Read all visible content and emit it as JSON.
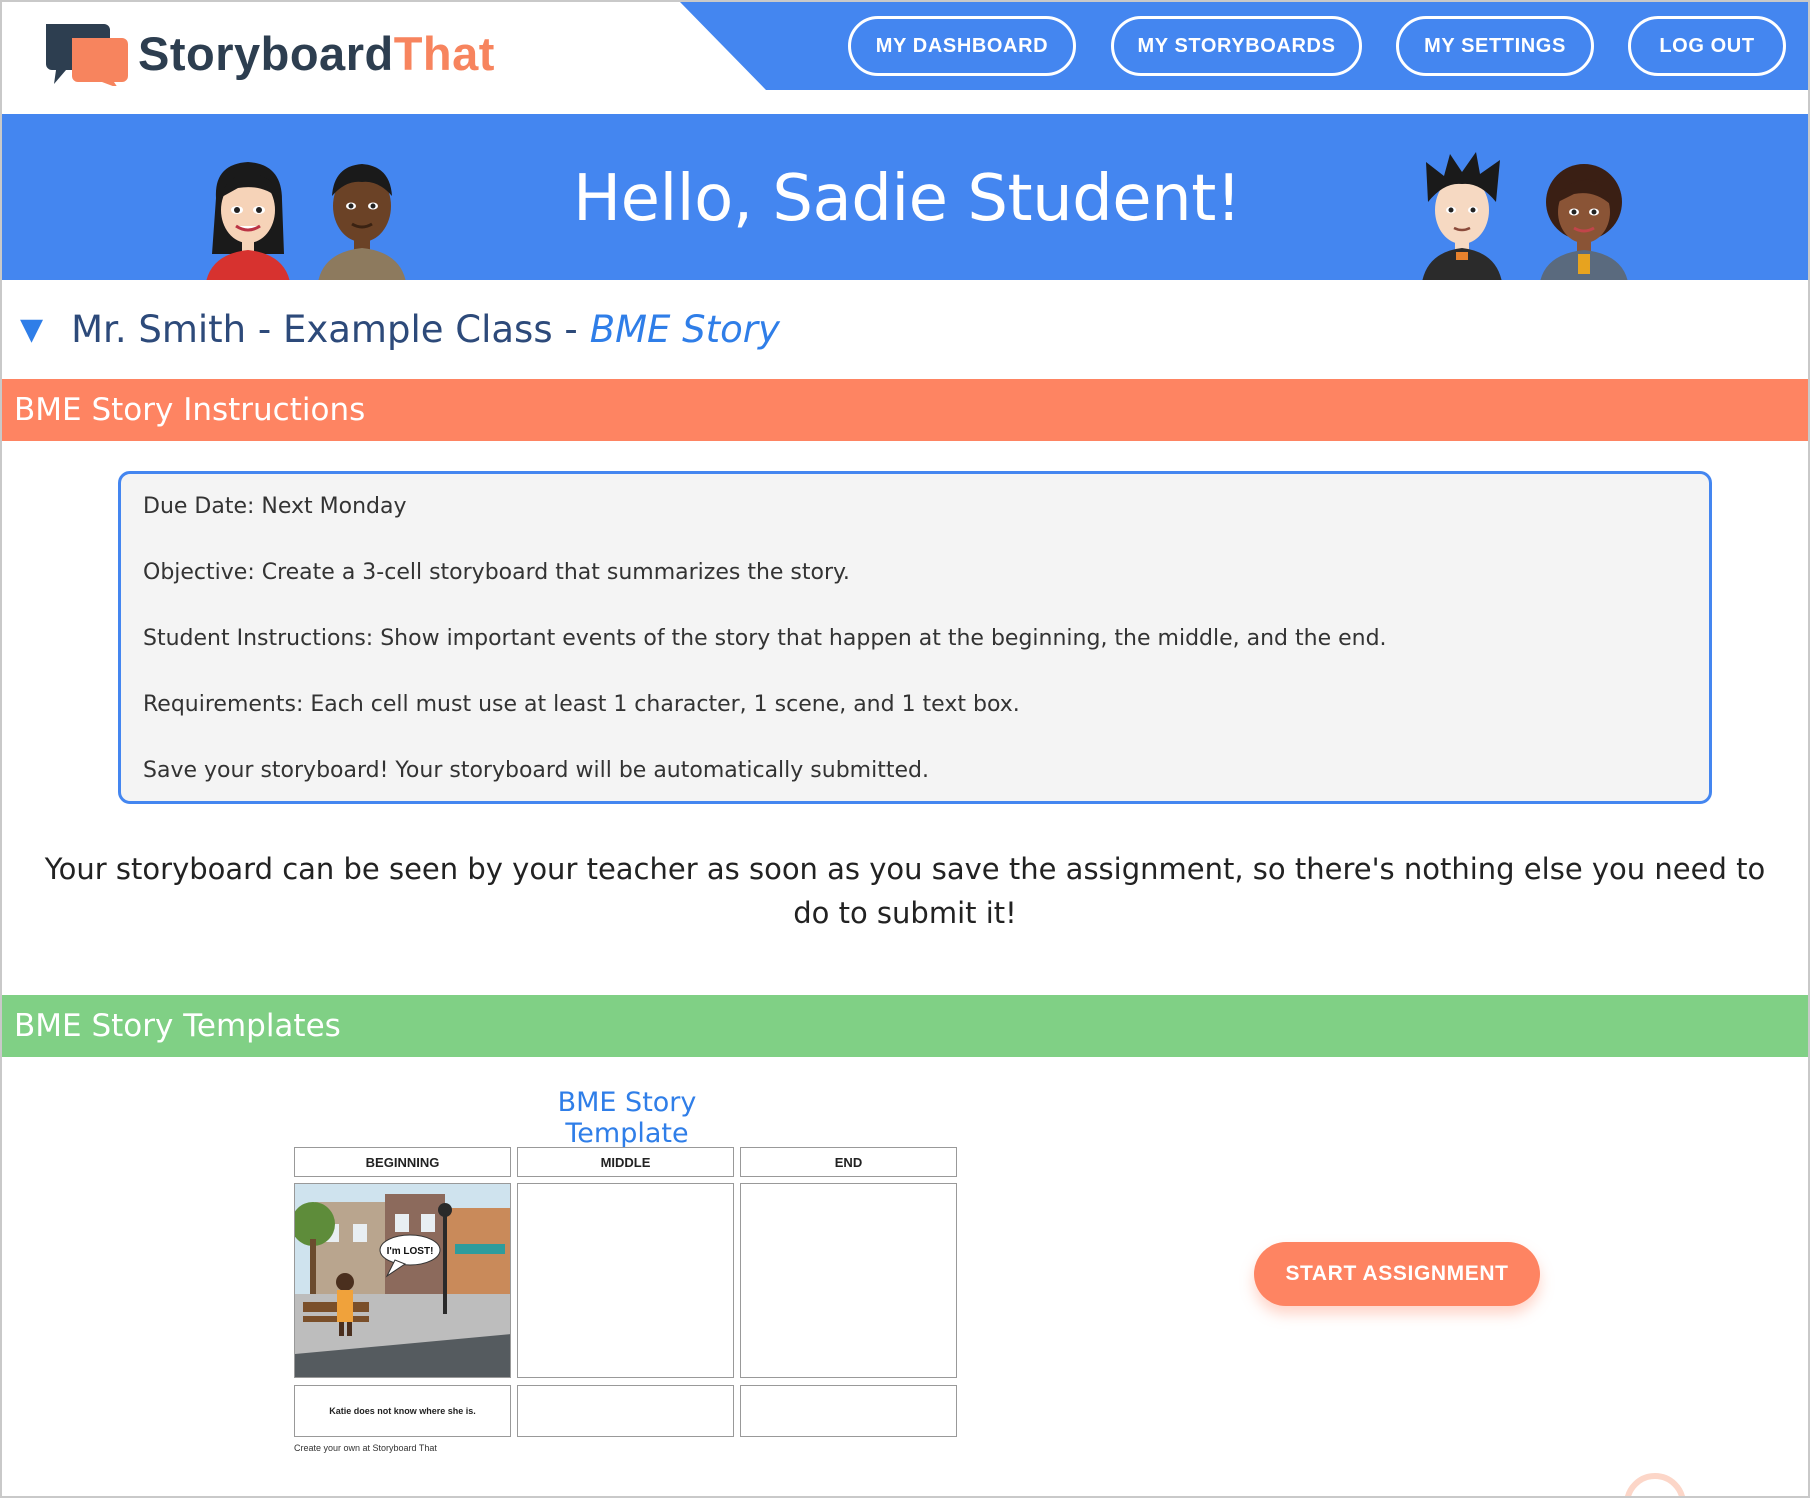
{
  "brand": {
    "name_part1": "Storyboard",
    "name_part2": "That",
    "colors": {
      "navy": "#2d3e50",
      "orange": "#f7845e",
      "blue": "#4486f0"
    }
  },
  "nav": {
    "items": [
      {
        "label": "MY DASHBOARD"
      },
      {
        "label": "MY STORYBOARDS"
      },
      {
        "label": "MY SETTINGS"
      },
      {
        "label": "LOG OUT"
      }
    ]
  },
  "banner": {
    "greeting": "Hello, Sadie Student!"
  },
  "class_heading": {
    "toggle_icon": "triangle-down-icon",
    "class_name": "Mr. Smith - Example Class -",
    "assignment": "BME Story"
  },
  "instructions": {
    "title": "BME Story Instructions",
    "lines": [
      "Due Date: Next Monday",
      "Objective: Create a 3-cell storyboard that summarizes the story.",
      "Student Instructions: Show important events of the story that happen at the beginning, the middle, and the end.",
      "Requirements: Each cell must use at least 1 character, 1 scene, and 1 text box.",
      "Save your storyboard! Your storyboard will be automatically submitted."
    ],
    "notice": "Your storyboard can be seen by your teacher as soon as you save the assignment, so there's nothing else you need to do to submit it!"
  },
  "templates": {
    "title": "BME Story Templates",
    "template_name": "BME Story Template",
    "storyboard": {
      "headers": [
        "BEGINNING",
        "MIDDLE",
        "END"
      ],
      "speech": "I'm LOST!",
      "captions": [
        "Katie does not know where she is.",
        "",
        ""
      ],
      "credit": "Create your own at Storyboard That"
    },
    "start_button": "START ASSIGNMENT"
  }
}
